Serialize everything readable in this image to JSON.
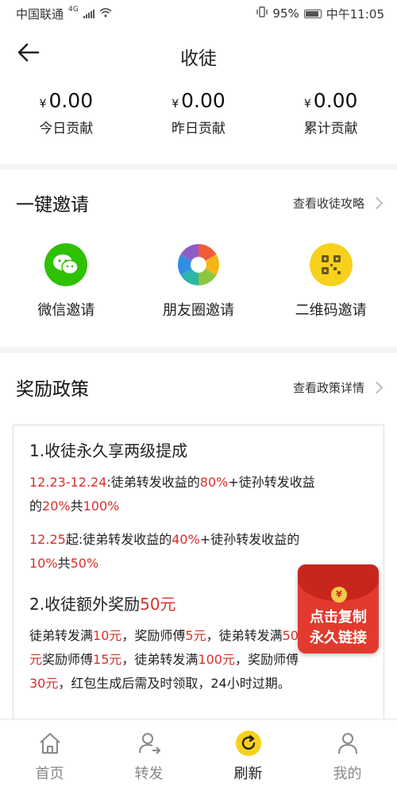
{
  "status_bar": {
    "carrier": "中国联通",
    "network": "4G",
    "battery": "95%",
    "time": "中午11:05"
  },
  "header": {
    "title": "收徒"
  },
  "stats": [
    {
      "value": "0.00",
      "currency": "¥",
      "label": "今日贡献"
    },
    {
      "value": "0.00",
      "currency": "¥",
      "label": "昨日贡献"
    },
    {
      "value": "0.00",
      "currency": "¥",
      "label": "累计贡献"
    }
  ],
  "invite_section": {
    "title": "一键邀请",
    "link": "查看收徒攻略",
    "items": [
      {
        "label": "微信邀请",
        "icon": "wechat-icon"
      },
      {
        "label": "朋友圈邀请",
        "icon": "moments-icon"
      },
      {
        "label": "二维码邀请",
        "icon": "qrcode-icon"
      }
    ]
  },
  "policy_section": {
    "title": "奖励政策",
    "link": "查看政策详情",
    "rule1": {
      "head": "1.收徒永久享两级提成",
      "l1": {
        "a": "12.23-12.24",
        "b": ":徒弟转发收益的",
        "c": "80%",
        "d": "+徒孙转发收益"
      },
      "l2": {
        "a": "的",
        "b": "20%",
        "c": "共",
        "d": "100%"
      },
      "l3": {
        "a": "12.25",
        "b": "起:徒弟转发收益的",
        "c": "40%",
        "d": "+徒孙转发收益的"
      },
      "l4": {
        "a": "10%",
        "b": "共",
        "c": "50%"
      }
    },
    "rule2": {
      "head_a": "2.收徒额外奖励",
      "head_b": "50元",
      "l1": {
        "a": "徒弟转发满",
        "b": "10元",
        "c": "，奖励师傅",
        "d": "5元",
        "e": "，徒弟转发满",
        "f": "50"
      },
      "l2": {
        "a": "元",
        "b": "奖励师傅",
        "c": "15元",
        "d": "，徒弟转发满",
        "e": "100元",
        "f": "，奖励师傅"
      },
      "l3": {
        "a": "30元",
        "b": "，红包生成后需及时领取，24小时过期。"
      }
    }
  },
  "red_packet": {
    "line1": "点击复制",
    "line2": "永久链接",
    "coin": "¥"
  },
  "bottom_nav": [
    {
      "label": "首页",
      "icon": "home-icon"
    },
    {
      "label": "转发",
      "icon": "share-user-icon"
    },
    {
      "label": "刷新",
      "icon": "refresh-icon"
    },
    {
      "label": "我的",
      "icon": "profile-icon"
    }
  ],
  "colors": {
    "accent_red": "#d9302c",
    "wechat_green": "#2dc100",
    "qr_yellow": "#f7d11c",
    "refresh_yellow": "#f7d11c"
  }
}
